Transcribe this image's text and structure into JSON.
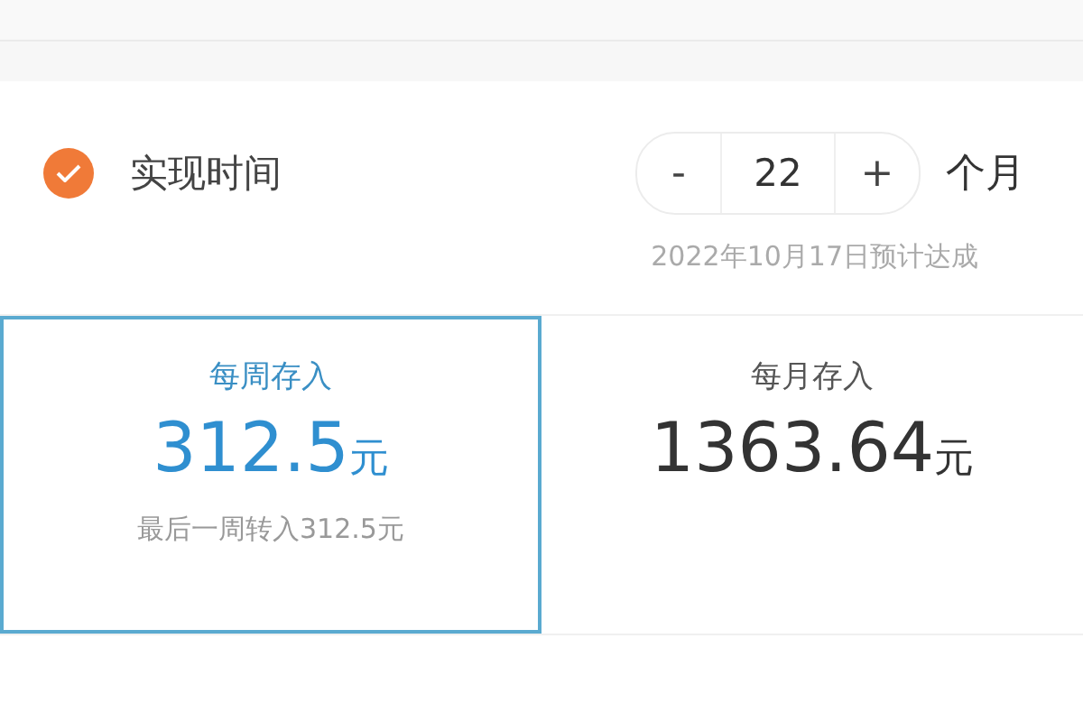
{
  "goal_time": {
    "label": "实现时间",
    "checked": true,
    "stepper": {
      "minus": "-",
      "value": "22",
      "plus": "+"
    },
    "unit": "个月",
    "note": "2022年10月17日预计达成"
  },
  "plans": [
    {
      "title": "每周存入",
      "amount": "312.5",
      "unit": "元",
      "note": "最后一周转入312.5元",
      "selected": true
    },
    {
      "title": "每月存入",
      "amount": "1363.64",
      "unit": "元",
      "selected": false
    }
  ]
}
